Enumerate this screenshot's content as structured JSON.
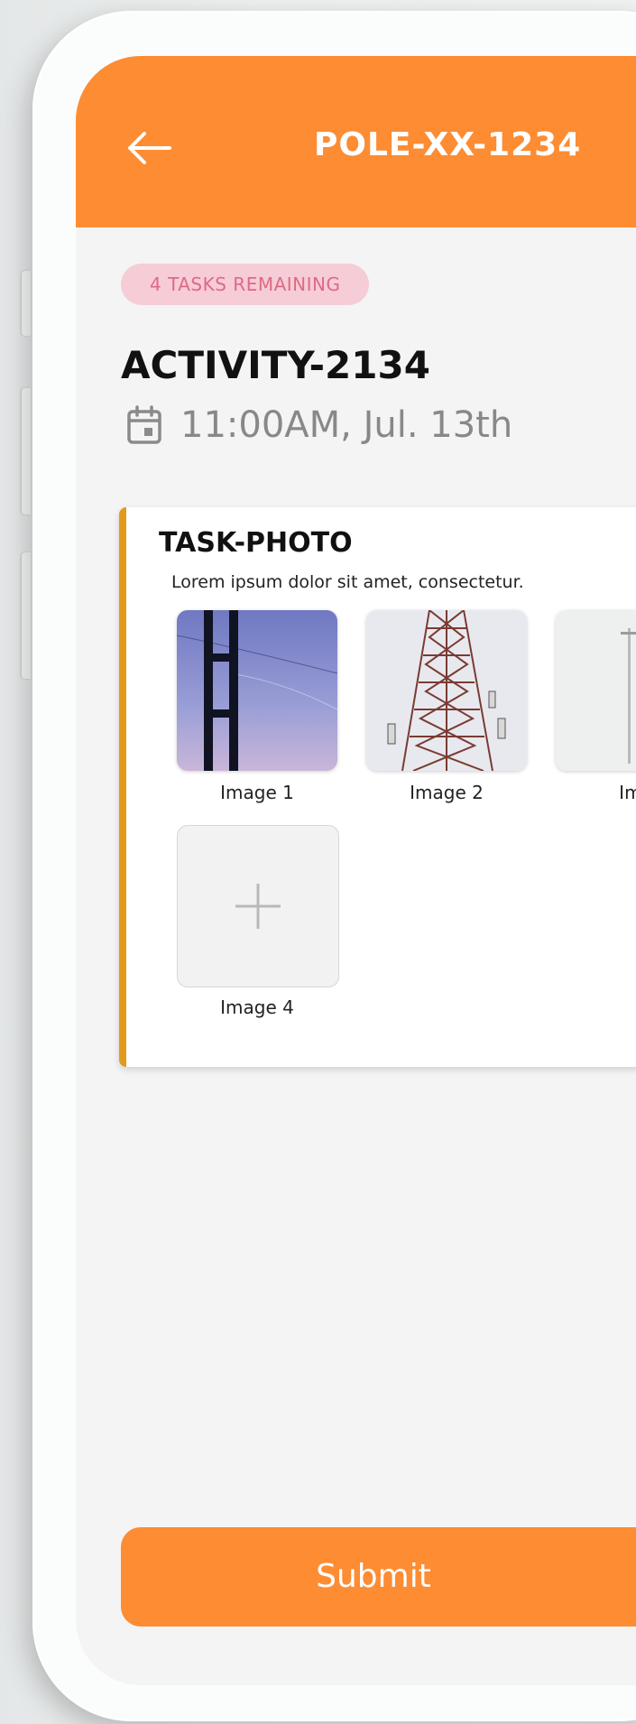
{
  "header": {
    "title": "POLE-XX-1234",
    "back_icon": "arrow-left-icon"
  },
  "badge": {
    "label": "4 TASKS REMAINING"
  },
  "activity": {
    "title": "ACTIVITY-2134",
    "datetime": "11:00AM, Jul. 13th",
    "date_icon": "calendar-icon"
  },
  "task": {
    "title": "TASK-PHOTO",
    "description": "Lorem ipsum dolor sit amet, consectetur.",
    "images": [
      {
        "label": "Image 1"
      },
      {
        "label": "Image 2"
      },
      {
        "label": "Ima"
      },
      {
        "label": "Image 4"
      }
    ],
    "add_icon": "plus-icon"
  },
  "submit": {
    "label": "Submit"
  },
  "colors": {
    "brand_orange": "#fd8c33",
    "badge_bg": "#f6ccd6",
    "badge_text": "#de6a86",
    "card_accent": "#e29a1d"
  }
}
